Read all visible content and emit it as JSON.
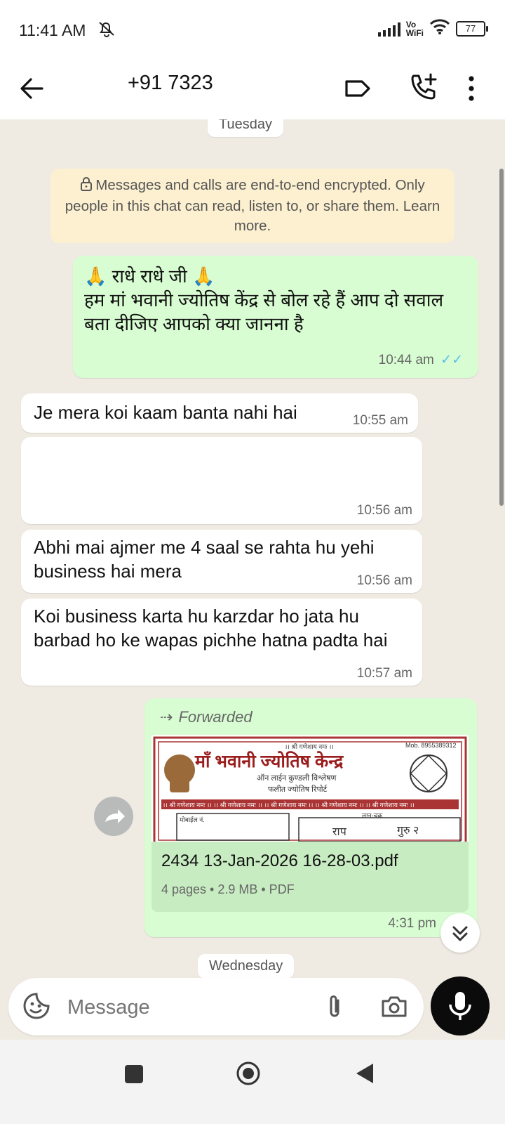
{
  "status_bar": {
    "time": "11:41 AM",
    "vo_label": "Vo",
    "wifi_label": "WiFi",
    "battery": "77"
  },
  "header": {
    "contact": "+91 7323"
  },
  "chat": {
    "date_top": "Tuesday",
    "date_bottom": "Wednesday",
    "encryption_notice": "Messages and calls are end-to-end encrypted. Only people in this chat can read, listen to, or share them. Learn more.",
    "messages": [
      {
        "direction": "outgoing",
        "line1": "🙏 राधे राधे जी 🙏",
        "line2": "हम मां भवानी ज्योतिष केंद्र से बोल रहे हैं आप दो सवाल बता दीजिए आपको क्या जानना है",
        "time": "10:44 am"
      },
      {
        "direction": "incoming",
        "text": "Je mera koi kaam banta nahi hai",
        "time": "10:55 am"
      },
      {
        "direction": "incoming",
        "text": "",
        "time": "10:56 am"
      },
      {
        "direction": "incoming",
        "text": "Abhi mai ajmer me 4 saal se rahta hu yehi business hai mera",
        "time": "10:56 am"
      },
      {
        "direction": "incoming",
        "text": "Koi business karta hu karzdar ho jata hu barbad ho ke wapas pichhe hatna padta hai",
        "time": "10:57 am"
      },
      {
        "direction": "outgoing",
        "forwarded_label": "Forwarded",
        "document": {
          "file_name": "2434 13-Jan-2026 16-28-03.pdf",
          "meta": "4 pages • 2.9 MB • PDF",
          "preview_title": "माँ भवानी ज्योतिष केन्द्र",
          "preview_subtitle1": "ऑन लाईन कुण्डली विश्लेषण",
          "preview_subtitle2": "फलीत ज्योतिष रिपोर्ट",
          "preview_header": "।। श्री गणेशाय नमः ।।",
          "preview_mobile": "Mob. 8955389312",
          "preview_band": "।। श्री गणेशाय नमः ।। ।। श्री गणेशाय नमः ।। ।। श्री गणेशाय नमः ।। ।। श्री गणेशाय नमः ।। ।। श्री गणेशाय नमः ।।",
          "preview_field": "मोबाईल नं.",
          "preview_lagna": "लग्न-चक्र",
          "preview_num1": "राप",
          "preview_num2": "गुरु २"
        },
        "time": "4:31 pm"
      }
    ]
  },
  "composer": {
    "placeholder": "Message"
  },
  "colors": {
    "outgoing_bubble": "#d8fdd2",
    "incoming_bubble": "#ffffff",
    "chat_background": "#efeae2",
    "read_ticks": "#53bdeb"
  },
  "icons": [
    "dnd-icon",
    "signal-icon",
    "wifi-icon",
    "battery-icon",
    "back-arrow-icon",
    "label-icon",
    "add-call-icon",
    "more-vert-icon",
    "lock-icon",
    "double-check-icon",
    "forward-icon",
    "share-icon",
    "chevron-double-down-icon",
    "sticker-icon",
    "attach-icon",
    "camera-icon",
    "mic-icon",
    "nav-recents-icon",
    "nav-home-icon",
    "nav-back-icon"
  ]
}
